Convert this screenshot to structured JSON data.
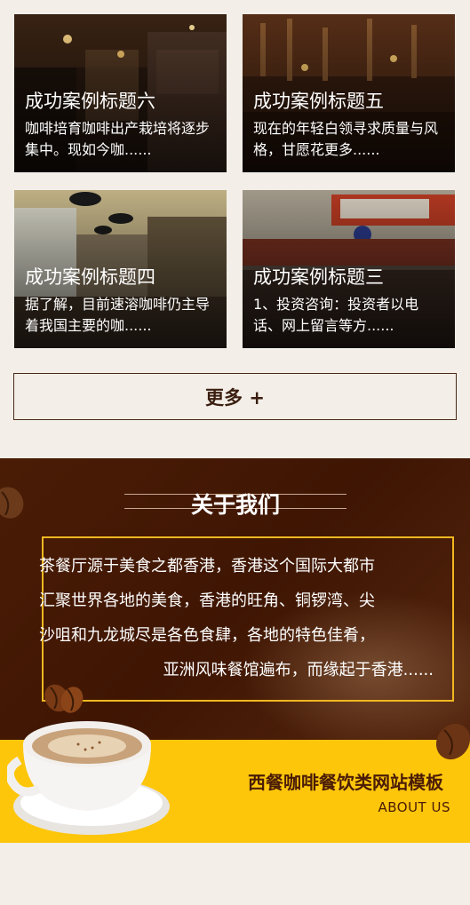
{
  "cases": [
    {
      "title": "成功案例标题六",
      "desc": "咖啡培育咖啡出产栽培将逐步集中。现如今咖......"
    },
    {
      "title": "成功案例标题五",
      "desc": "现在的年轻白领寻求质量与风格，甘愿花更多......"
    },
    {
      "title": "成功案例标题四",
      "desc": "据了解，目前速溶咖啡仍主导着我国主要的咖......"
    },
    {
      "title": "成功案例标题三",
      "desc": "1、投资咨询：投资者以电话、网上留言等方......"
    }
  ],
  "more_button": "更多 +",
  "about": {
    "heading": "关于我们",
    "paragraph_lines": [
      "茶餐厅源于美食之都香港，香港这个国际大都市",
      "汇聚世界各地的美食，香港的旺角、铜锣湾、尖",
      "沙咀和九龙城尽是各色食肆，各地的特色佳肴，",
      "亚洲风味餐馆遍布，而缘起于香港......"
    ],
    "site_title": "西餐咖啡餐饮类网站模板",
    "sub_title": "ABOUT US"
  },
  "colors": {
    "page_bg": "#f3eee7",
    "about_bg": "#4a1c06",
    "accent_yellow": "#fdc60b",
    "frame_gold": "#f0b820"
  }
}
